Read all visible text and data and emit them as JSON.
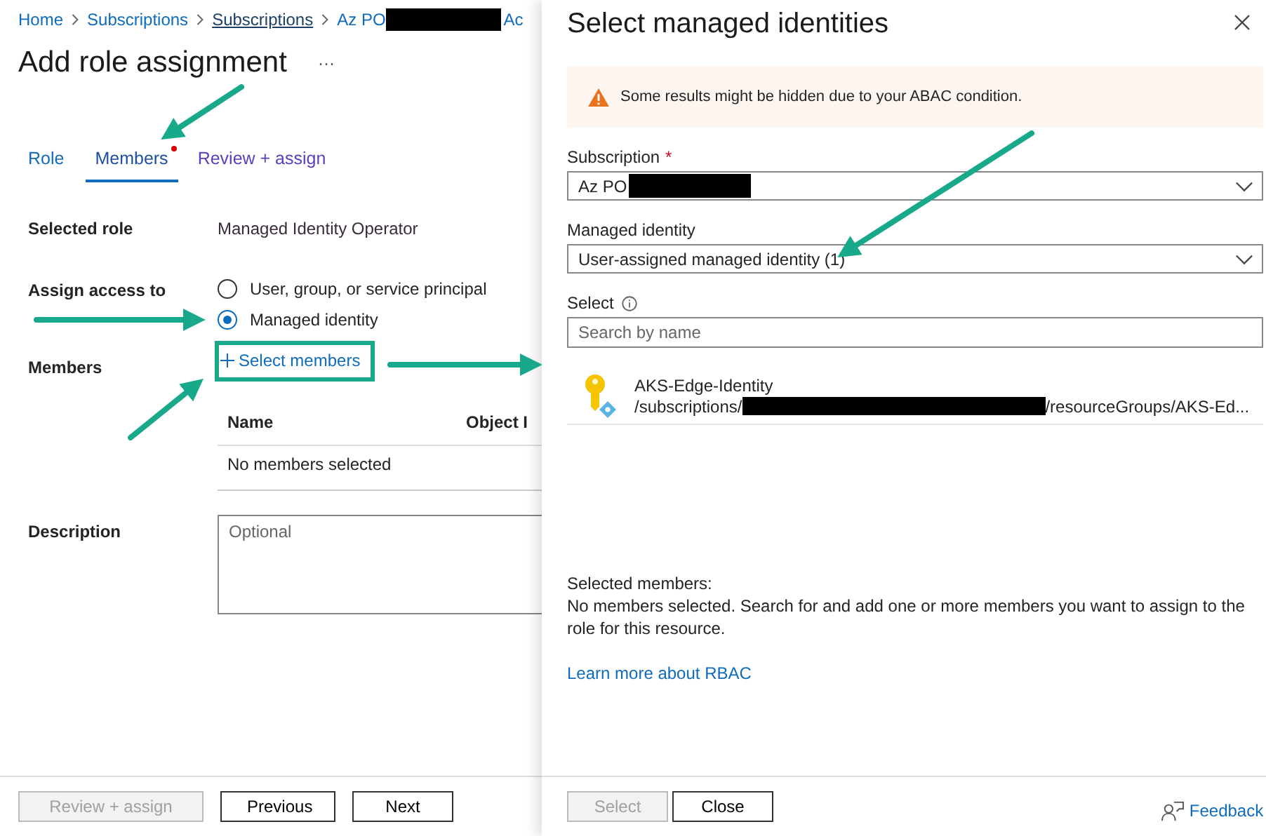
{
  "breadcrumb": [
    {
      "label": "Home",
      "hovered": false,
      "redacted": false
    },
    {
      "label": "Subscriptions",
      "hovered": false,
      "redacted": false
    },
    {
      "label": "Subscriptions",
      "hovered": true,
      "redacted": false
    },
    {
      "label": "Az PO",
      "hovered": false,
      "redacted": true,
      "after": "Ac"
    }
  ],
  "page": {
    "title": "Add role assignment",
    "more": "···"
  },
  "tabs": [
    {
      "label": "Role",
      "selected": false,
      "alert": false,
      "visited": false
    },
    {
      "label": "Members",
      "selected": true,
      "alert": true,
      "visited": false
    },
    {
      "label": "Review + assign",
      "selected": false,
      "alert": false,
      "visited": true
    }
  ],
  "form": {
    "selected_role_label": "Selected role",
    "selected_role": "Managed Identity Operator",
    "assign_label": "Assign access to",
    "assign_options": [
      {
        "label": "User, group, or service principal",
        "selected": false
      },
      {
        "label": "Managed identity",
        "selected": true
      }
    ],
    "members_label": "Members",
    "select_members": "Select members",
    "members_table": {
      "columns": [
        "Name",
        "Object I"
      ],
      "empty": "No members selected"
    },
    "description_label": "Description",
    "description_placeholder": "Optional"
  },
  "footer": [
    {
      "label": "Review + assign",
      "disabled": true
    },
    {
      "label": "Previous",
      "disabled": false
    },
    {
      "label": "Next",
      "disabled": false
    }
  ],
  "panel": {
    "title": "Select managed identities",
    "warning": "Some results might be hidden due to your ABAC condition.",
    "subscription_label": "Subscription",
    "subscription_required": "*",
    "subscription_value": "Az PO",
    "subscription_redacted": true,
    "identity_label": "Managed identity",
    "identity_value": "User-assigned managed identity (1)",
    "select_label": "Select",
    "search_placeholder": "Search by name",
    "results": [
      {
        "name": "AKS-Edge-Identity",
        "path_start": "/subscriptions/",
        "redacted": true,
        "path_end": "/resourceGroups/AKS-Ed..."
      }
    ],
    "selected_heading": "Selected members:",
    "selected_text": "No members selected. Search for and add one or more members you want to assign to the role for this resource.",
    "learn_more": "Learn more about RBAC",
    "buttons": [
      {
        "label": "Select",
        "disabled": true
      },
      {
        "label": "Close",
        "disabled": false
      }
    ],
    "feedback": "Feedback"
  }
}
